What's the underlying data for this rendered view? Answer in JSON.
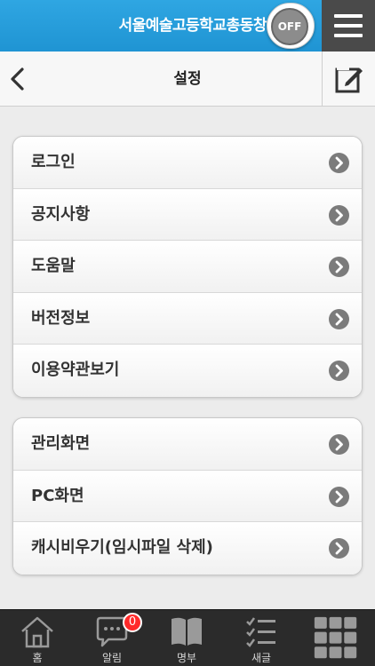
{
  "topbar": {
    "title": "서울예술고등학교총동창",
    "toggle_label": "OFF"
  },
  "header": {
    "title": "설정"
  },
  "groups": [
    {
      "items": [
        {
          "label": "로그인"
        },
        {
          "label": "공지사항"
        },
        {
          "label": "도움말"
        },
        {
          "label": "버전정보"
        },
        {
          "label": "이용약관보기"
        }
      ]
    },
    {
      "items": [
        {
          "label": "관리화면"
        },
        {
          "label": "PC화면"
        },
        {
          "label": "캐시비우기(임시파일 삭제)"
        }
      ]
    }
  ],
  "tabbar": {
    "tabs": [
      {
        "label": "홈",
        "icon": "home-icon"
      },
      {
        "label": "알림",
        "icon": "chat-icon",
        "badge": "0"
      },
      {
        "label": "명부",
        "icon": "book-icon"
      },
      {
        "label": "새글",
        "icon": "checklist-icon"
      },
      {
        "label": "",
        "icon": "grid-icon"
      }
    ]
  },
  "colors": {
    "topbar": "#1f94d3",
    "badge": "#ff2a2a",
    "tabbar": "#2b2b2b"
  }
}
